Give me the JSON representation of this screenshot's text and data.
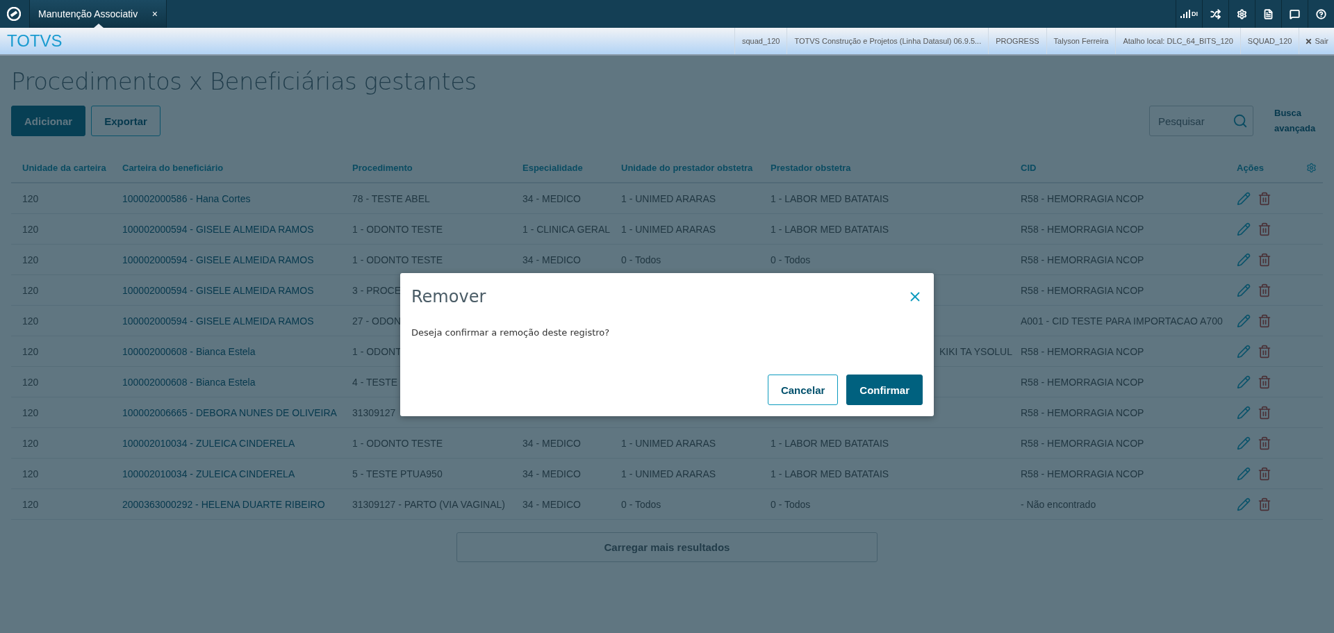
{
  "top_bar": {
    "tab": {
      "label": "Manutenção Associativ",
      "close": "×",
      "selected": true
    },
    "signal_label": "DI"
  },
  "info_bar": {
    "logo": "TOTVS",
    "items": [
      "squad_120",
      "TOTVS Construção e Projetos (Linha Datasul) 06.9.5...",
      "PROGRESS",
      "Talyson Ferreira",
      "Atalho local: DLC_64_BITS_120",
      "SQUAD_120"
    ],
    "logout": "Sair"
  },
  "page": {
    "title": "Procedimentos x Beneficiárias gestantes",
    "buttons": [
      {
        "label": "Adicionar",
        "kind": "primary"
      },
      {
        "label": "Exportar",
        "kind": "secondary"
      }
    ],
    "search": {
      "placeholder": "Pesquisar"
    },
    "advanced_search": "Busca avançada"
  },
  "table": {
    "columns": [
      "Unidade da carteira",
      "Carteira do beneficiário",
      "Procedimento",
      "Especialidade",
      "Unidade do prestador obstetra",
      "Prestador obstetra",
      "CID",
      "Ações"
    ],
    "rows": [
      {
        "cells": [
          "120",
          "100002000586 - Hana Cortes",
          "78 - TESTE ABEL",
          "34 - MEDICO",
          "1 - UNIMED ARARAS",
          "1 - LABOR MED BATATAIS",
          "R58 - HEMORRAGIA NCOP"
        ]
      },
      {
        "cells": [
          "120",
          "100002000594 - GISELE ALMEIDA RAMOS",
          "1 - ODONTO TESTE",
          "1 - CLINICA GERAL",
          "1 - UNIMED ARARAS",
          "1 - LABOR MED BATATAIS",
          "R58 - HEMORRAGIA NCOP"
        ]
      },
      {
        "cells": [
          "120",
          "100002000594 - GISELE ALMEIDA RAMOS",
          "1 - ODONTO TESTE",
          "34 - MEDICO",
          "0 - Todos",
          "0 - Todos",
          "R58 - HEMORRAGIA NCOP"
        ]
      },
      {
        "cells": [
          "120",
          "100002000594 - GISELE ALMEIDA RAMOS",
          "3 - PROCE",
          null,
          null,
          null,
          "R58 - HEMORRAGIA NCOP"
        ]
      },
      {
        "cells": [
          "120",
          "100002000594 - GISELE ALMEIDA RAMOS",
          "27 - ODON",
          null,
          null,
          null,
          "A001 - CID TESTE PARA IMPORTACAO A700"
        ]
      },
      {
        "cells": [
          "120",
          "100002000608 - Bianca Estela",
          "1 - ODONT",
          null,
          null,
          "KIKI TA YSOLUL",
          "R58 - HEMORRAGIA NCOP"
        ],
        "clipped_right": true
      },
      {
        "cells": [
          "120",
          "100002000608 - Bianca Estela",
          "4 - TESTE",
          null,
          null,
          null,
          "R58 - HEMORRAGIA NCOP"
        ]
      },
      {
        "cells": [
          "120",
          "100002006665 - DEBORA NUNES DE OLIVEIRA",
          "31309127",
          null,
          null,
          null,
          "R58 - HEMORRAGIA NCOP"
        ]
      },
      {
        "cells": [
          "120",
          "100002010034 - ZULEICA CINDERELA",
          "1 - ODONTO TESTE",
          "34 - MEDICO",
          "1 - UNIMED ARARAS",
          "1 - LABOR MED BATATAIS",
          "R58 - HEMORRAGIA NCOP"
        ]
      },
      {
        "cells": [
          "120",
          "100002010034 - ZULEICA CINDERELA",
          "5 - TESTE PTUA950",
          "34 - MEDICO",
          "1 - UNIMED ARARAS",
          "1 - LABOR MED BATATAIS",
          "R58 - HEMORRAGIA NCOP"
        ]
      },
      {
        "cells": [
          "120",
          "2000363000292 - HELENA DUARTE RIBEIRO",
          "31309127 - PARTO (VIA VAGINAL)",
          "34 - MEDICO",
          "0 - Todos",
          "0 - Todos",
          "- Não encontrado"
        ]
      }
    ],
    "load_more": "Carregar mais resultados"
  },
  "modal": {
    "title": "Remover",
    "message": "Deseja confirmar a remoção deste registro?",
    "buttons": [
      {
        "label": "Cancelar",
        "kind": "secondary"
      },
      {
        "label": "Confirmar",
        "kind": "primary"
      }
    ]
  }
}
